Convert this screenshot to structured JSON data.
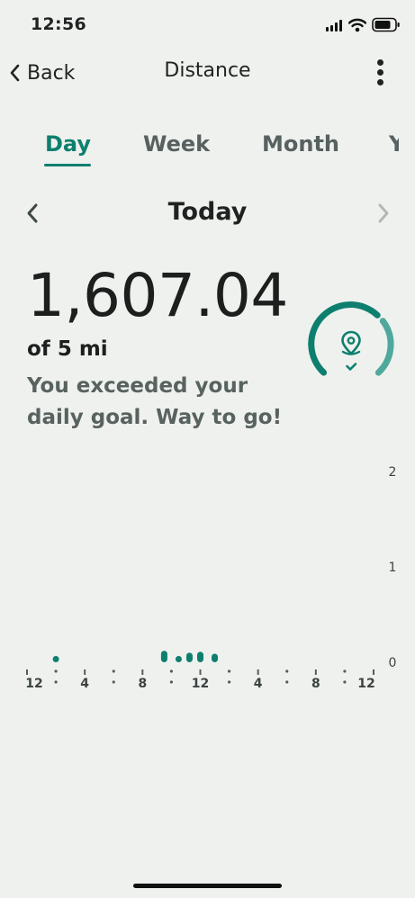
{
  "status_bar": {
    "time": "12:56"
  },
  "nav": {
    "back_label": "Back",
    "title": "Distance"
  },
  "tabs": [
    {
      "label": "Day",
      "active": true
    },
    {
      "label": "Week",
      "active": false
    },
    {
      "label": "Month",
      "active": false
    },
    {
      "label": "Y",
      "active": false
    }
  ],
  "date_nav": {
    "label": "Today"
  },
  "summary": {
    "value": "1,607.04",
    "goal_text": "of 5 mi",
    "message": "You exceeded your daily goal. Way to go!"
  },
  "gauge": {
    "icon": "location-pin-icon",
    "status_icon": "check-icon",
    "progress": 1.0
  },
  "colors": {
    "accent": "#0d7f6f",
    "accent_light": "#4fa89c",
    "background": "#eff1ee"
  },
  "chart_data": {
    "type": "bar",
    "y_ticks": [
      "2",
      "1",
      "0"
    ],
    "ylim": [
      0,
      2
    ],
    "x_tick_labels": [
      "12",
      "4",
      "8",
      "12",
      "4",
      "8",
      "12"
    ],
    "x_range_hours": [
      0,
      24
    ],
    "bars": [
      {
        "hour": 2.0,
        "value": 0.04
      },
      {
        "hour": 9.5,
        "value": 0.12
      },
      {
        "hour": 10.5,
        "value": 0.05
      },
      {
        "hour": 11.25,
        "value": 0.1
      },
      {
        "hour": 12.0,
        "value": 0.11
      },
      {
        "hour": 13.0,
        "value": 0.09
      }
    ]
  }
}
